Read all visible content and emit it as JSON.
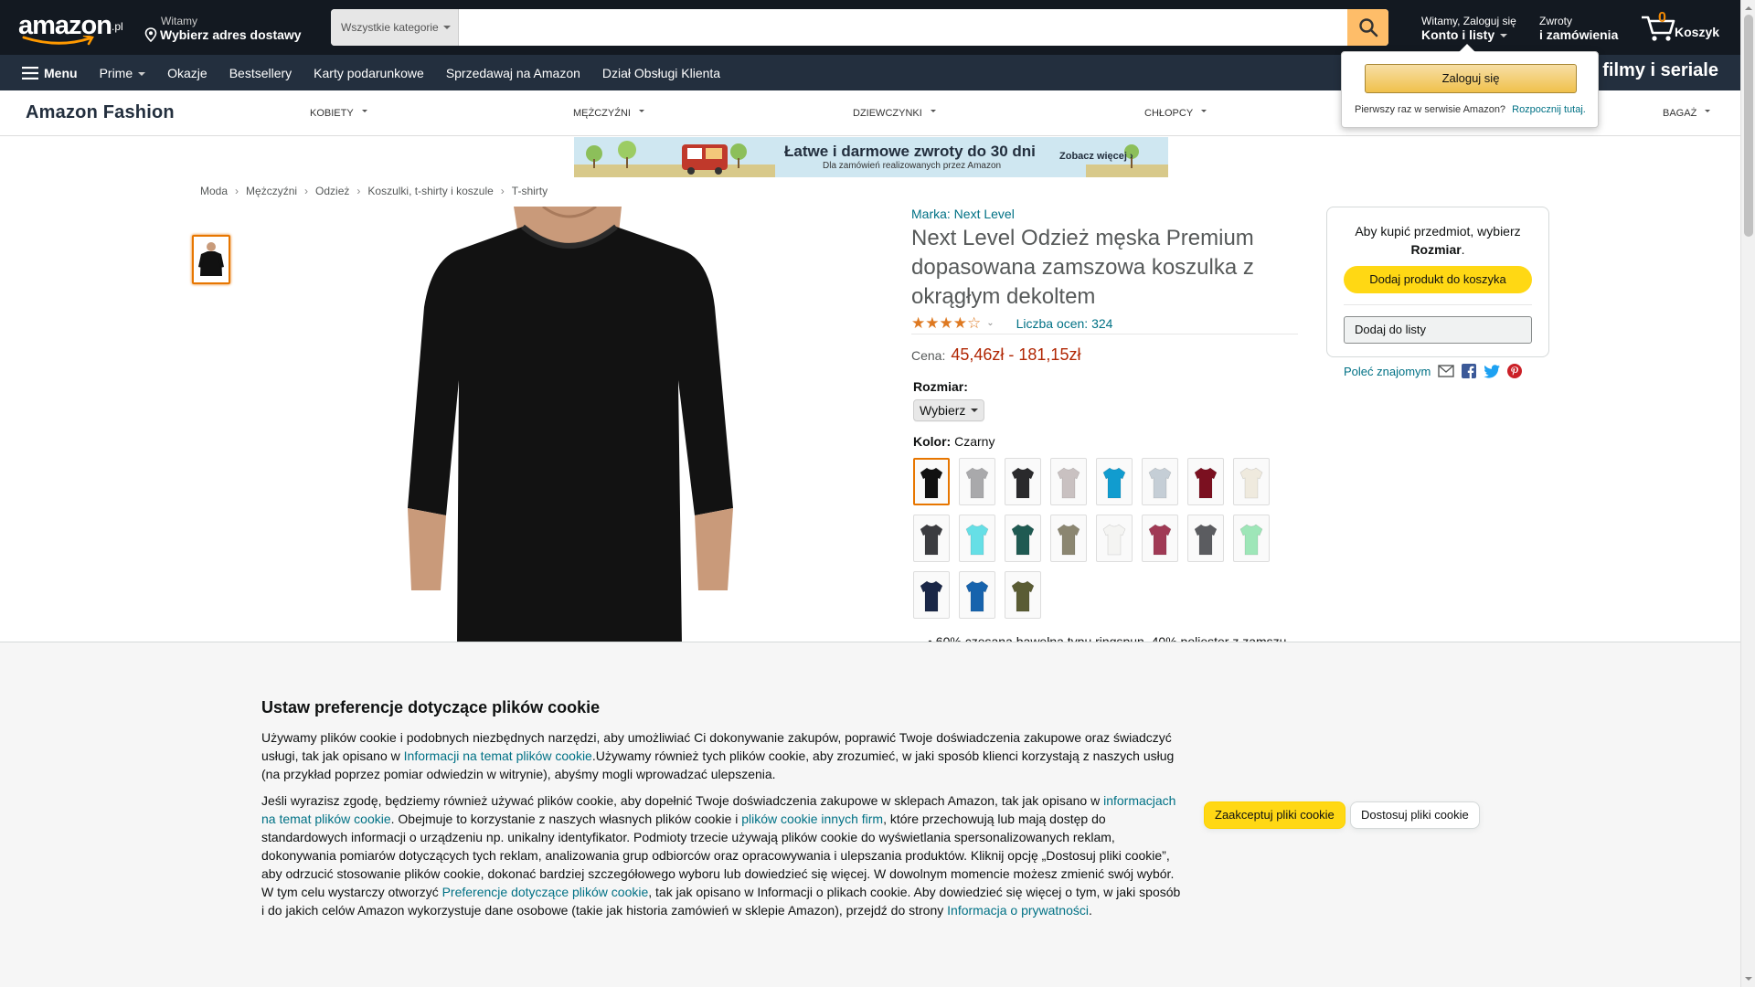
{
  "nav": {
    "logo_text": "amazon",
    "logo_tld": ".pl",
    "deliver_line1": "Witamy",
    "deliver_line2": "Wybierz adres dostawy",
    "search_category": "Wszystkie kategorie",
    "search_placeholder": "",
    "account_line1": "Witamy, Zaloguj się",
    "account_line2": "Konto i listy",
    "returns_line1": "Zwroty",
    "returns_line2": "i zamówienia",
    "cart_count": "0",
    "cart_label": "Koszyk"
  },
  "subnav": {
    "menu": "Menu",
    "items": [
      "Prime",
      "Okazje",
      "Bestsellery",
      "Karty podarunkowe",
      "Sprzedawaj na Amazon",
      "Dział Obsługi Klienta"
    ],
    "promo": "filmy i seriale"
  },
  "fashion": {
    "brand": "Amazon Fashion",
    "categories": [
      "KOBIETY",
      "MĘŻCZYŹNI",
      "DZIEWCZYNKI",
      "CHŁOPCY",
      "BAGAŻ"
    ]
  },
  "banner": {
    "title": "Łatwe i darmowe zwroty do 30 dni",
    "subtitle": "Dla zamówień realizowanych przez Amazon",
    "more": "Zobacz więcej ›"
  },
  "breadcrumb": [
    "Moda",
    "Mężczyźni",
    "Odzież",
    "Koszulki, t-shirty i koszule",
    "T-shirty"
  ],
  "product": {
    "brand": "Marka: Next Level",
    "title": "Next Level Odzież męska Premium dopasowana zamszowa koszulka z okrągłym dekoltem",
    "rating_stars": "★★★★☆",
    "rating_count": "Liczba ocen: 324",
    "price_label": "Cena:",
    "price": "45,46zł - 181,15zł",
    "size_label": "Rozmiar:",
    "size_value": "Wybierz",
    "color_label": "Kolor:",
    "color_value": "Czarny",
    "bullet": "60% czesana bawełna typu ringspun, 40% poliester z zamszu",
    "swatch_colors": [
      "#111111",
      "#a9a9ab",
      "#2a2a2c",
      "#c9c1c1",
      "#119ccf",
      "#c5ced6",
      "#7b1020",
      "#efeade",
      "#3b3c40",
      "#66dfe6",
      "#1f5a52",
      "#8b8671",
      "#f4f4f2",
      "#a03a55",
      "#5b5c60",
      "#9ee6b8",
      "#1a2747",
      "#1763ad",
      "#5a5c34"
    ]
  },
  "buybox": {
    "msg_prefix": "Aby kupić przedmiot, wybierz",
    "msg_bold": "Rozmiar",
    "add_to_cart": "Dodaj produkt do koszyka",
    "add_to_list": "Dodaj do listy",
    "share": "Poleć znajomym"
  },
  "flyout": {
    "signin": "Zaloguj się",
    "new_customer": "Pierwszy raz w serwisie Amazon?",
    "start_here": "Rozpocznij tutaj."
  },
  "cookie": {
    "title": "Ustaw preferencje dotyczące plików cookie",
    "p1_a": "Używamy plików cookie i podobnych niezbędnych narzędzi, aby umożliwiać Ci dokonywanie zakupów, poprawić Twoje doświadczenia zakupowe oraz świadczyć usługi, tak jak opisano w ",
    "p1_link": "Informacji na temat plików cookie",
    "p1_b": ".Używamy również tych plików cookie, aby zrozumieć, w jaki sposób klienci korzystają z naszych usług (na przykład poprzez pomiar odwiedzin w witrynie), abyśmy mogli wprowadzać ulepszenia.",
    "p2_a": "Jeśli wyrazisz zgodę, będziemy również używać plików cookie, aby dopełnić Twoje doświadczenia zakupowe w sklepach Amazon, tak jak opisano w ",
    "p2_link1": "informacjach na temat plików cookie",
    "p2_b": ". Obejmuje to korzystanie z naszych własnych plików cookie i ",
    "p2_link2": "plików cookie innych firm",
    "p2_c": ", które przechowują lub mają dostęp do standardowych informacji o urządzeniu np. unikalny identyfikator. Podmioty trzecie używają plików cookie do wyświetlania spersonalizowanych reklam, dokonywania pomiarów dotyczących tych reklam, analizowania grup odbiorców oraz opracowywania i ulepszania produktów. Kliknij opcję „Dostosuj pliki cookie”, aby odrzucić stosowanie plików cookie, dokonać bardziej szczegółowego wyboru lub dowiedzieć się więcej. W dowolnym momencie możesz zmienić swój wybór. W tym celu wystarczy otworzyć ",
    "p2_link3": "Preferencje dotyczące plików cookie",
    "p2_d": ", tak jak opisano w Informacji o plikach cookie. Aby dowiedzieć się więcej o tym, w jaki sposób i do jakich celów Amazon wykorzystuje dane osobowe (takie jak historia zamówień w sklepie Amazon), przejdź do strony ",
    "p2_link4": "Informacja o prywatności",
    "p2_e": ".",
    "accept": "Zaakceptuj pliki cookie",
    "customize": "Dostosuj pliki cookie"
  }
}
